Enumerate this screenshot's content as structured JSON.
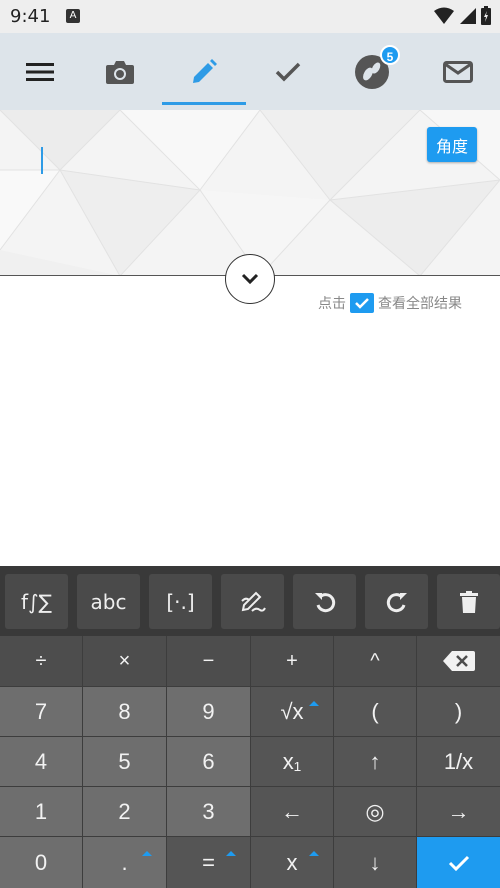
{
  "status_bar": {
    "time": "9:41",
    "notif_glyph": "A"
  },
  "toolbar": {
    "items": [
      {
        "name": "menu-icon"
      },
      {
        "name": "camera-icon"
      },
      {
        "name": "pencil-icon",
        "active": true
      },
      {
        "name": "checkmark-icon"
      },
      {
        "name": "footprints-icon",
        "badge": "5"
      },
      {
        "name": "mail-icon"
      }
    ],
    "accent": "#2e9be6"
  },
  "editor": {
    "angle_label": "角度",
    "results_prefix": "点击",
    "results_suffix": "查看全部结果"
  },
  "function_keys": [
    "f∫∑",
    "abc",
    "[·.]",
    "handwrite-icon",
    "undo-icon",
    "redo-icon",
    "trash-icon"
  ],
  "keypad": {
    "row1": [
      "÷",
      "×",
      "−",
      "+",
      "^"
    ],
    "row2": [
      "7",
      "8",
      "9",
      "√x",
      "(",
      ")"
    ],
    "row3": [
      "4",
      "5",
      "6",
      "x₁",
      "↑",
      "1/x"
    ],
    "row4": [
      "1",
      "2",
      "3",
      "←",
      "◎",
      "→"
    ],
    "row5": [
      "0",
      ".",
      "=",
      "x",
      "↓"
    ]
  },
  "colors": {
    "accent": "#1e9bf0",
    "keyboard_bg": "#3d3d3d"
  }
}
